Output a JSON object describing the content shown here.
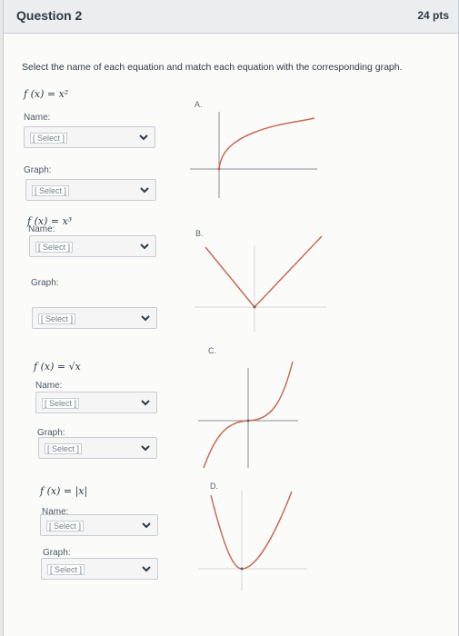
{
  "question": {
    "title": "Question 2",
    "points": "24 pts",
    "instructions": "Select the name of each equation and match each equation with the corresponding graph."
  },
  "items": [
    {
      "equation": "f (x) = x²",
      "name_label": "Name:",
      "name_value": "[ Select ]",
      "graph_label": "Graph:",
      "graph_value": "[ Select ]"
    },
    {
      "equation": "f (x) = x³",
      "name_label": "Name:",
      "name_value": "[ Select ]",
      "graph_label": "Graph:",
      "graph_value": "[ Select ]"
    },
    {
      "equation": "f (x) = √x",
      "name_label": "Name:",
      "name_value": "[ Select ]",
      "graph_label": "Graph:",
      "graph_value": "[ Select ]"
    },
    {
      "equation": "f (x) = |x|",
      "name_label": "Name:",
      "name_value": "[ Select ]",
      "graph_label": "Graph:",
      "graph_value": "[ Select ]"
    }
  ],
  "graphs": [
    {
      "letter": "A.",
      "curve": "square-root"
    },
    {
      "letter": "B.",
      "curve": "absolute-value"
    },
    {
      "letter": "C.",
      "curve": "cubic"
    },
    {
      "letter": "D.",
      "curve": "quadratic"
    }
  ],
  "colors": {
    "curve": "#c86a52",
    "axis": "#8a8f93",
    "grid": "#d4d6d8"
  }
}
